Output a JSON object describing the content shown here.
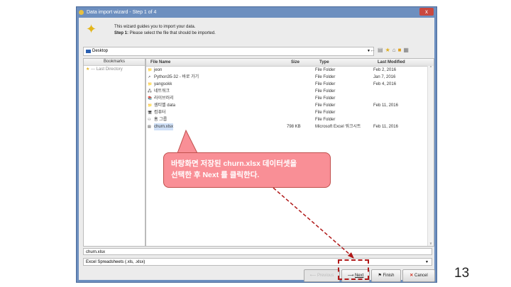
{
  "window": {
    "title": "Data import wizard - Step 1 of 4",
    "close": "x"
  },
  "header": {
    "line1": "This wizard guides you to import your data.",
    "step_label": "Step 1:",
    "step_text": " Please select the file that should be imported."
  },
  "location": {
    "value": "Desktop"
  },
  "bookmarks": {
    "header": "Bookmarks",
    "items": [
      "--- Last Directory"
    ]
  },
  "files": {
    "columns": [
      "File Name",
      "Size",
      "Type",
      "Last Modified"
    ],
    "rows": [
      {
        "name": "jeon",
        "size": "",
        "type": "File Folder",
        "modified": "Feb 2, 2016"
      },
      {
        "name": "Python35-32 - 바로 가기",
        "size": "",
        "type": "File Folder",
        "modified": "Jan 7, 2016"
      },
      {
        "name": "yangsokk",
        "size": "",
        "type": "File Folder",
        "modified": "Feb 4, 2016"
      },
      {
        "name": "네트워크",
        "size": "",
        "type": "File Folder",
        "modified": ""
      },
      {
        "name": "라이브러리",
        "size": "",
        "type": "File Folder",
        "modified": ""
      },
      {
        "name": "셈티벨 data",
        "size": "",
        "type": "File Folder",
        "modified": "Feb 11, 2016"
      },
      {
        "name": "컴퓨터",
        "size": "",
        "type": "File Folder",
        "modified": ""
      },
      {
        "name": "홈 그룹",
        "size": "",
        "type": "File Folder",
        "modified": ""
      },
      {
        "name": "churn.xlsx",
        "size": "798 KB",
        "type": "Microsoft Excel 워크시트",
        "modified": "Feb 11, 2016"
      }
    ]
  },
  "filename": {
    "value": "churn.xlsx"
  },
  "filetype": {
    "value": "Excel Spreadsheets (.xls, .xlsx)"
  },
  "buttons": {
    "previous": "Previous",
    "next": "Next",
    "finish": "Finish",
    "cancel": "Cancel"
  },
  "callout": {
    "line1": "바탕화면 저장된 churn.xlsx 데이터셋을",
    "line2": "선택한 후 Next 를 클릭한다."
  },
  "page_number": "13"
}
